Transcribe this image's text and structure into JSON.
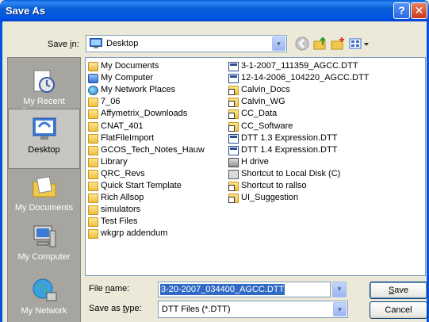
{
  "window": {
    "title": "Save As",
    "help": "?",
    "close": "✕"
  },
  "savein": {
    "label": "Save in:",
    "value": "Desktop"
  },
  "places": [
    {
      "id": "recent",
      "label": "My Recent Documents"
    },
    {
      "id": "desktop",
      "label": "Desktop",
      "selected": true
    },
    {
      "id": "mydocs",
      "label": "My Documents"
    },
    {
      "id": "mycomputer",
      "label": "My Computer"
    },
    {
      "id": "network",
      "label": "My Network"
    }
  ],
  "files_col1": [
    {
      "name": "My Documents",
      "icon": "mydocs"
    },
    {
      "name": "My Computer",
      "icon": "mycomp"
    },
    {
      "name": "My Network Places",
      "icon": "mynet"
    },
    {
      "name": "7_06",
      "icon": "folder"
    },
    {
      "name": "Affymetrix_Downloads",
      "icon": "folder"
    },
    {
      "name": "CNAT_401",
      "icon": "folder"
    },
    {
      "name": "FlatFileImport",
      "icon": "folder"
    },
    {
      "name": "GCOS_Tech_Notes_Hauw",
      "icon": "folder"
    },
    {
      "name": "Library",
      "icon": "folder"
    },
    {
      "name": "QRC_Revs",
      "icon": "folder"
    },
    {
      "name": "Quick Start Template",
      "icon": "folder"
    },
    {
      "name": "Rich Allsop",
      "icon": "folder"
    },
    {
      "name": "simulators",
      "icon": "folder"
    },
    {
      "name": "Test Files",
      "icon": "folder"
    },
    {
      "name": "wkgrp addendum",
      "icon": "folder"
    }
  ],
  "files_col2": [
    {
      "name": "3-1-2007_111359_AGCC.DTT",
      "icon": "dtt"
    },
    {
      "name": "12-14-2006_104220_AGCC.DTT",
      "icon": "dtt"
    },
    {
      "name": "Calvin_Docs",
      "icon": "folder-sc"
    },
    {
      "name": "Calvin_WG",
      "icon": "folder-sc"
    },
    {
      "name": "CC_Data",
      "icon": "folder-sc"
    },
    {
      "name": "CC_Software",
      "icon": "folder-sc"
    },
    {
      "name": "DTT 1.3 Expression.DTT",
      "icon": "dtt"
    },
    {
      "name": "DTT 1.4 Expression.DTT",
      "icon": "dtt"
    },
    {
      "name": "H drive",
      "icon": "netdrive"
    },
    {
      "name": "Shortcut to Local Disk (C)",
      "icon": "sc-generic"
    },
    {
      "name": "Shortcut to rallso",
      "icon": "folder-sc"
    },
    {
      "name": "UI_Suggestion",
      "icon": "folder-sc"
    }
  ],
  "filename": {
    "label_pre": "File ",
    "label_u": "n",
    "label_post": "ame:",
    "value": "3-20-2007_034400_AGCC.DTT"
  },
  "savetype": {
    "label_pre": "Save as ",
    "label_u": "t",
    "label_post": "ype:",
    "value": "DTT Files (*.DTT)"
  },
  "buttons": {
    "save_u": "S",
    "save_rest": "ave",
    "cancel": "Cancel"
  },
  "arrow": "▾"
}
